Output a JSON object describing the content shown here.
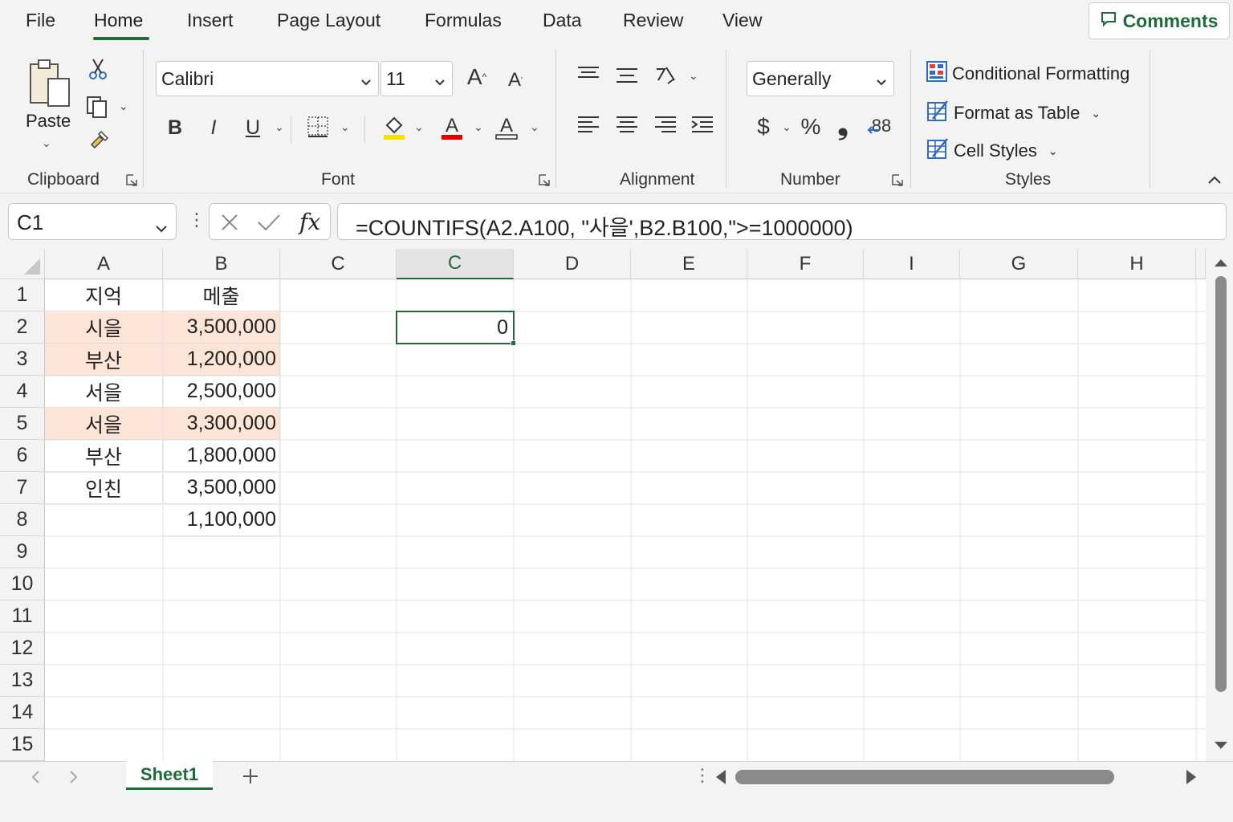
{
  "tabs": [
    {
      "label": "File"
    },
    {
      "label": "Home"
    },
    {
      "label": "Insert"
    },
    {
      "label": "Page Layout"
    },
    {
      "label": "Formulas"
    },
    {
      "label": "Data"
    },
    {
      "label": "Review"
    },
    {
      "label": "View"
    }
  ],
  "comments_label": "Comments",
  "clipboard": {
    "paste_label": "Paste",
    "group_label": "Clipboard"
  },
  "font": {
    "family": "Calibri",
    "size": "11",
    "group_label": "Font",
    "bold": "B",
    "italic": "I",
    "underline": "U"
  },
  "alignment": {
    "group_label": "Alignment"
  },
  "number": {
    "format": "Generally",
    "group_label": "Number",
    "currency": "$",
    "percent": "%",
    "comma": "❟"
  },
  "styles": {
    "conditional_formatting": "Conditional Formatting",
    "format_as_table": "Format as Table",
    "cell_styles": "Cell Styles",
    "group_label": "Styles"
  },
  "formula_bar": {
    "name_box": "C1",
    "fx": "fx",
    "formula": "=COUNTIFS(A2.A100, \"사을',B2.B100,\">=1000000)"
  },
  "columns": [
    "A",
    "B",
    "C",
    "C",
    "D",
    "E",
    "F",
    "I",
    "G",
    "H"
  ],
  "rows": [
    "1",
    "2",
    "3",
    "4",
    "5",
    "6",
    "7",
    "8",
    "9",
    "10",
    "11",
    "12",
    "13",
    "14",
    "15"
  ],
  "cells": {
    "a1": "지억",
    "b1": "메출",
    "a2": "시을",
    "b2": "3,500,000",
    "a3": "부산",
    "b3": "1,200,000",
    "a4": "서을",
    "b4": "2,500,000",
    "a5": "서을",
    "b5": "3,300,000",
    "a6": "부산",
    "b6": "1,800,000",
    "a7": "인친",
    "b7": "3,500,000",
    "b8": "1,100,000",
    "active_value": "0"
  },
  "sheet_tab": "Sheet1",
  "colors": {
    "accent": "#1e6b3a",
    "highlight": "#fce4d6",
    "font_highlight": "#f5e100",
    "font_color": "#e00000"
  }
}
